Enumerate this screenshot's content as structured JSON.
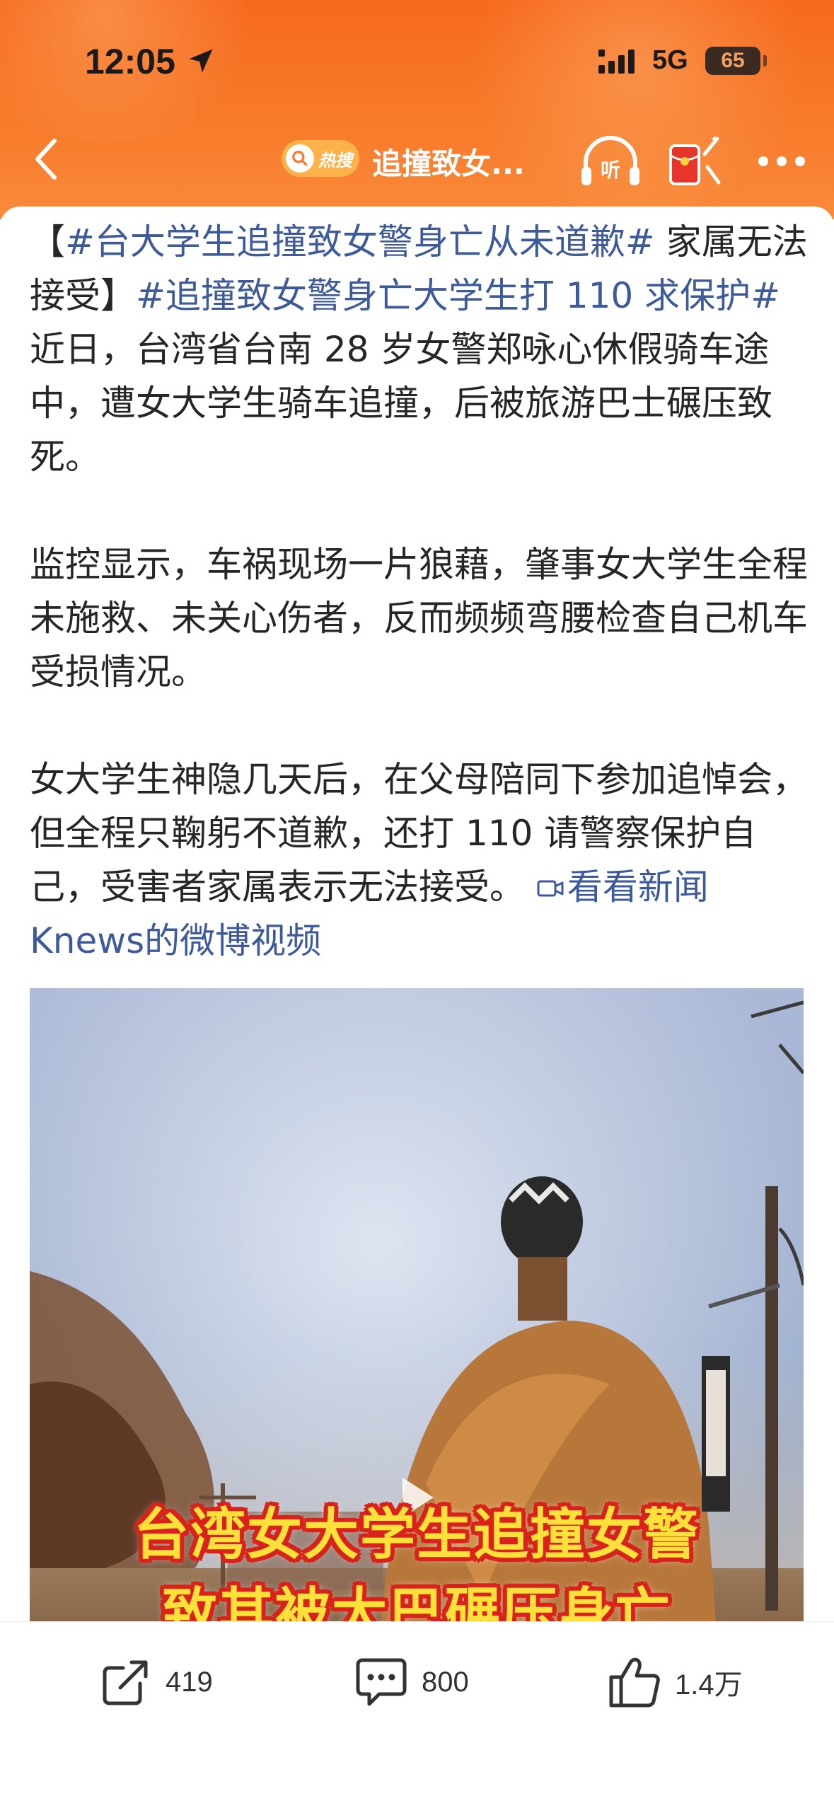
{
  "status_bar": {
    "time": "12:05",
    "network": "5G",
    "battery": "65",
    "battery_level": 0.65
  },
  "nav": {
    "hot_badge": "热搜",
    "title": "追撞致女...",
    "listen_label": "听"
  },
  "post": {
    "paragraph1": {
      "bracket_open": "【",
      "tag1": "#台大学生追撞致女警身亡从未道歉#",
      "text1": " 家属无法接受】",
      "tag2": "#追撞致女警身亡大学生打 110 求保护#",
      "text2": "近日，台湾省台南 28 岁女警郑咏心休假骑车途中，遭女大学生骑车追撞，后被旅游巴士碾压致死。"
    },
    "paragraph2": "监控显示，车祸现场一片狼藉，肇事女大学生全程未施救、未关心伤者，反而频频弯腰检查自己机车受损情况。",
    "paragraph3": "女大学生神隐几天后，在父母陪同下参加追悼会，但全程只鞠躬不道歉，还打 110 请警察保护自己，受害者家属表示无法接受。",
    "video_link": "看看新闻 Knews的微博视频"
  },
  "video": {
    "caption_line1": "台湾女大学生追撞女警",
    "caption_line2": "致其被大巴碾压身亡"
  },
  "actions": {
    "share_count": "419",
    "comment_count": "800",
    "like_count": "1.4万"
  },
  "colors": {
    "header": "#f6691d",
    "tag": "#3d5a9a",
    "caption_fill": "#ffe13a",
    "caption_stroke": "#d9221b"
  }
}
